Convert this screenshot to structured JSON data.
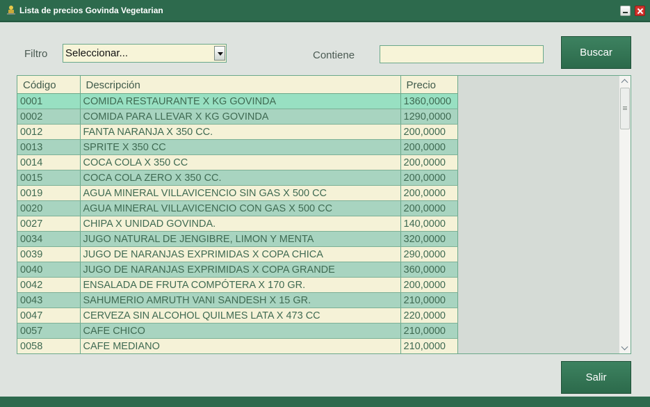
{
  "window": {
    "title": "Lista de precios Govinda Vegetarian",
    "icon": "app-icon"
  },
  "filters": {
    "filter_label": "Filtro",
    "filter_value": "Seleccionar...",
    "contains_label": "Contiene",
    "contains_value": "",
    "search_button": "Buscar"
  },
  "grid": {
    "columns": [
      "Código",
      "Descripción",
      "Precio"
    ],
    "selected_row": 0,
    "rows": [
      [
        "0001",
        "COMIDA RESTAURANTE X KG GOVINDA",
        "1360,0000"
      ],
      [
        "0002",
        "COMIDA PARA LLEVAR X KG GOVINDA",
        "1290,0000"
      ],
      [
        "0012",
        "FANTA NARANJA X 350  CC.",
        "200,0000"
      ],
      [
        "0013",
        "SPRITE X 350 CC",
        "200,0000"
      ],
      [
        "0014",
        "COCA COLA X 350 CC",
        "200,0000"
      ],
      [
        "0015",
        "COCA COLA ZERO X  350 CC.",
        "200,0000"
      ],
      [
        "0019",
        "AGUA MINERAL VILLAVICENCIO SIN GAS X 500 CC",
        "200,0000"
      ],
      [
        "0020",
        "AGUA MINERAL VILLAVICENCIO CON GAS X 500 CC",
        "200,0000"
      ],
      [
        "0027",
        "CHIPA  X UNIDAD  GOVINDA.",
        "140,0000"
      ],
      [
        "0034",
        "JUGO NATURAL DE JENGIBRE, LIMON Y MENTA",
        "320,0000"
      ],
      [
        "0039",
        "JUGO DE NARANJAS EXPRIMIDAS X COPA CHICA",
        "290,0000"
      ],
      [
        "0040",
        "JUGO DE NARANJAS EXPRIMIDAS X COPA GRANDE",
        "360,0000"
      ],
      [
        "0042",
        "ENSALADA DE FRUTA  COMPÓTERA X 170 GR.",
        "200,0000"
      ],
      [
        "0043",
        "SAHUMERIO AMRUTH VANI SANDESH X 15 GR.",
        "210,0000"
      ],
      [
        "0047",
        "CERVEZA SIN ALCOHOL QUILMES  LATA X 473 CC",
        "220,0000"
      ],
      [
        "0057",
        "CAFE CHICO",
        "210,0000"
      ],
      [
        "0058",
        "CAFE MEDIANO",
        "210,0000"
      ]
    ]
  },
  "footer": {
    "exit_button": "Salir"
  },
  "colors": {
    "frame": "#2d6a4d",
    "row_light": "#f5f2d7",
    "row_dark": "#a8d4c0",
    "row_selected": "#98e0c2",
    "text": "#3f6a52"
  }
}
